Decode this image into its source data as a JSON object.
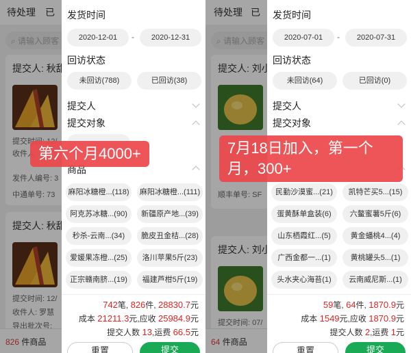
{
  "left": {
    "tabs": [
      "待处理",
      "已"
    ],
    "search_placeholder": "请输入顾客",
    "cards": [
      {
        "submitter": "提交人: 秋甜",
        "lines": [
          "提交时间: 12/",
          "收件人",
          "发件人编号: 3",
          "中通单号: 73"
        ]
      },
      {
        "submitter": "提交人: 秋甜",
        "lines": [
          "提交时间: 12/",
          "收件人: 罗慧",
          "导出批次号:"
        ]
      }
    ],
    "footer_count": "826",
    "footer_unit": "件商品",
    "filter": {
      "ship_time_label": "发货时间",
      "date_start": "2020-12-01",
      "date_sep": "-",
      "date_end": "2020-12-31",
      "visit_label": "回访状态",
      "not_visited": "未回访(788)",
      "visited": "已回访(38)",
      "submitter_label": "提交人",
      "target_label": "提交对象",
      "goods_label": "商品",
      "goods": [
        "麻阳冰糖橙...(118)",
        "麻阳冰糖橙...(111)",
        "阿克苏冰糖...(90)",
        "新疆原产地...(39)",
        "秒杀-云南...(34)",
        "脆皮丑金桔...(28)",
        "爱媛果冻橙...(25)",
        "洛川苹果5斤(23)",
        "正宗赣南脐...(19)",
        "福建芦柑5斤(19)"
      ],
      "summary": {
        "orders": "742",
        "orders_unit": "笔,",
        "items": "826",
        "items_unit": "件,",
        "amount": "28830.7",
        "yuan": "元",
        "cost_label": "成本",
        "cost": "21211.3",
        "cost_unit": "元,应收",
        "receivable": "25984.9",
        "recv_unit": "元",
        "submitter_label": "提交人数",
        "submitters": "13",
        "freight_label": ",运费",
        "freight": "66.5",
        "freight_unit": "元"
      },
      "reset_label": "重置",
      "submit_label": "提交"
    },
    "annotation": "第六个月4000+"
  },
  "right": {
    "tabs": [
      "待处理",
      "已"
    ],
    "search_placeholder": "请输入顾客",
    "cards": [
      {
        "submitter": "提交人: 刘小",
        "lines": [
          "顺丰单号: SF"
        ]
      },
      {
        "submitter": "提交人: 刘小",
        "lines": [
          "提交时间: 07/"
        ]
      }
    ],
    "footer_count": "64",
    "footer_unit": "件商品",
    "filter": {
      "ship_time_label": "发货时间",
      "date_start": "2020-07-01",
      "date_sep": "-",
      "date_end": "2020-07-31",
      "visit_label": "回访状态",
      "not_visited": "未回访(64)",
      "visited": "已回访(0)",
      "submitter_label": "提交人",
      "target_label": "提交对象",
      "goods": [
        "民勤沙漠蜜...(21)",
        "凯特芒买5...(15)",
        "蛋黄酥单盒装(6)",
        "六鳌蜜薯5斤(6)",
        "山东栖霞红...(5)",
        "黄金蟠桃4...(4)",
        "广西金都一...(1)",
        "黄桃罐头5...(1)",
        "头水夹心海苔(1)",
        "云南威尼斯...(1)"
      ],
      "summary": {
        "orders": "59",
        "orders_unit": "笔,",
        "items": "64",
        "items_unit": "件,",
        "amount": "1870.9",
        "yuan": "元",
        "cost_label": "成本",
        "cost": "1549",
        "cost_unit": "元,应收",
        "receivable": "1870.9",
        "recv_unit": "元",
        "submitter_label": "提交人数",
        "submitters": "2",
        "freight_label": ",运费",
        "freight": "1",
        "freight_unit": "元"
      },
      "reset_label": "重置",
      "submit_label": "提交"
    },
    "annotation_line1": "7月18日加入，第一个",
    "annotation_line2": "月，300+"
  },
  "colors": {
    "green": "#1aaa55",
    "red": "#e02424",
    "annotation": "#eb464b"
  }
}
